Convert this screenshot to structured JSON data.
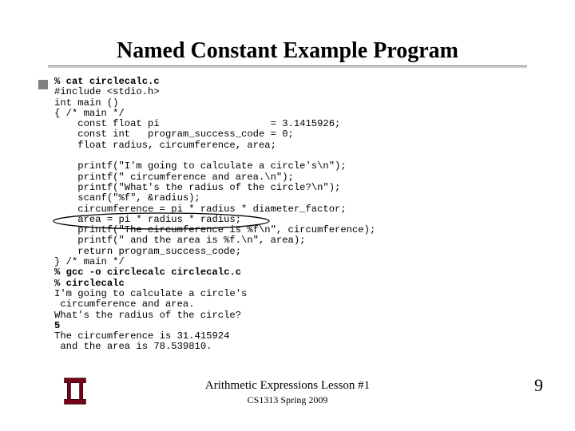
{
  "title": "Named Constant Example Program",
  "code_lines": [
    {
      "t": "% cat circlecalc.c",
      "b": true
    },
    {
      "t": "#include <stdio.h>"
    },
    {
      "t": "int main ()"
    },
    {
      "t": "{ /* main */"
    },
    {
      "t": "    const float pi                   = 3.1415926;"
    },
    {
      "t": "    const int   program_success_code = 0;"
    },
    {
      "t": "    float radius, circumference, area;"
    },
    {
      "t": ""
    },
    {
      "t": "    printf(\"I'm going to calculate a circle's\\n\");"
    },
    {
      "t": "    printf(\" circumference and area.\\n\");"
    },
    {
      "t": "    printf(\"What's the radius of the circle?\\n\");"
    },
    {
      "t": "    scanf(\"%f\", &radius);"
    },
    {
      "t": "    circumference = pi * radius * diameter_factor;"
    },
    {
      "t": "    area = pi * radius * radius;"
    },
    {
      "t": "    printf(\"The circumference is %f\\n\", circumference);"
    },
    {
      "t": "    printf(\" and the area is %f.\\n\", area);"
    },
    {
      "t": "    return program_success_code;"
    },
    {
      "t": "} /* main */"
    },
    {
      "t": "% gcc -o circlecalc circlecalc.c",
      "b": true
    },
    {
      "t": "% circlecalc",
      "b": true
    },
    {
      "t": "I'm going to calculate a circle's"
    },
    {
      "t": " circumference and area."
    },
    {
      "t": "What's the radius of the circle?"
    },
    {
      "t": "5",
      "b": true
    },
    {
      "t": "The circumference is 31.415924"
    },
    {
      "t": " and the area is 78.539810."
    }
  ],
  "footer": {
    "line1": "Arithmetic Expressions Lesson #1",
    "line2": "CS1313 Spring 2009"
  },
  "page_number": "9"
}
